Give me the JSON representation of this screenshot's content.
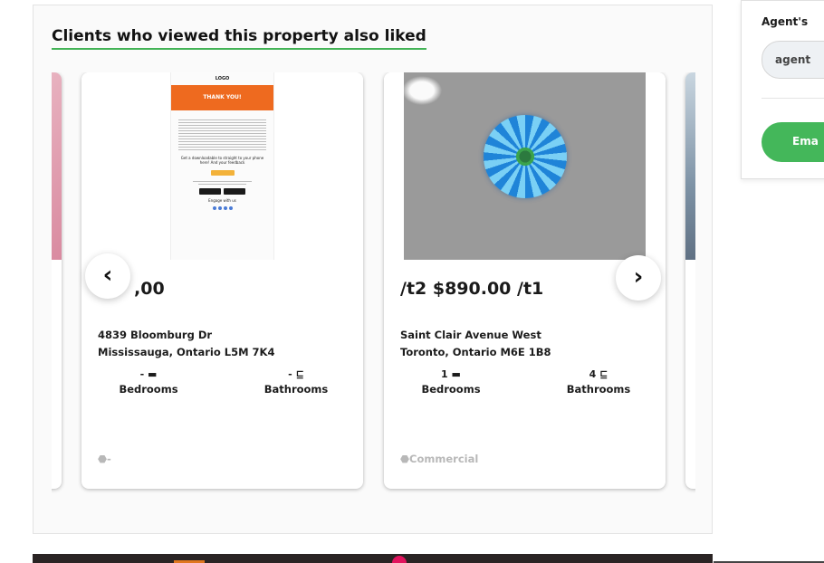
{
  "section": {
    "title": "Clients who viewed this property also liked"
  },
  "listings": [
    {
      "price": ",00",
      "address_line1": "4839 Bloomburg Dr",
      "address_line2": "Mississauga, Ontario L5M 7K4",
      "bedrooms_value": "-",
      "bedrooms_icon": "bed-icon",
      "bedrooms_label": "Bedrooms",
      "bathrooms_value": "-",
      "bathrooms_icon": "bathtub-icon",
      "bathrooms_label": "Bathrooms",
      "tag": "-",
      "tag_icon": "tag-icon",
      "image": {
        "logo": "LOGO",
        "banner": "THANK YOU!",
        "heading": "Get a downloadable to straight to your phone here! And your feedback",
        "footer": "Engage with us"
      }
    },
    {
      "price": "/t2 $890.00 /t1",
      "address_line1": "Saint Clair Avenue West",
      "address_line2": "Toronto, Ontario M6E 1B8",
      "bedrooms_value": "1",
      "bedrooms_icon": "bed-icon",
      "bedrooms_label": "Bedrooms",
      "bathrooms_value": "4",
      "bathrooms_icon": "bathtub-icon",
      "bathrooms_label": "Bathrooms",
      "tag": "Commercial",
      "tag_icon": "tag-icon"
    }
  ],
  "carousel": {
    "prev_icon": "chevron-left-icon",
    "next_icon": "chevron-right-icon",
    "prev_glyph": "‹",
    "next_glyph": "›"
  },
  "agent_form": {
    "label": "Agent's",
    "input_value": "agent",
    "button_label": "Ema"
  },
  "colors": {
    "accent_green": "#43b356",
    "button_green": "#44b75a",
    "email_banner_orange": "#ee6a1f",
    "footer_dark": "#2a2424"
  }
}
